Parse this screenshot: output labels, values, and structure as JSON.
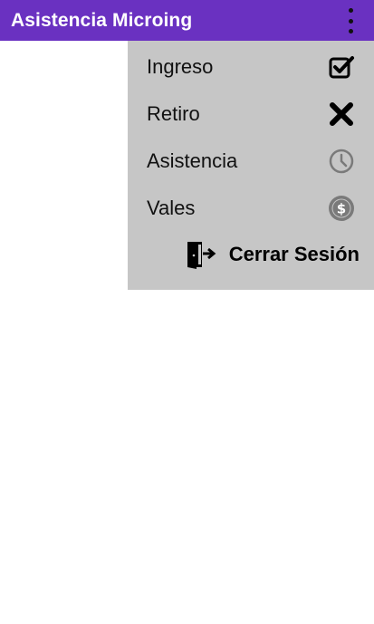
{
  "app_bar": {
    "title": "Asistencia Microing",
    "background": "#6a31c1",
    "overflow_icon": "more-vert-icon"
  },
  "menu": {
    "background": "#c6c6c6",
    "items": [
      {
        "label": "Ingreso",
        "icon": "checkbox-checked-icon"
      },
      {
        "label": "Retiro",
        "icon": "x-mark-icon"
      },
      {
        "label": "Asistencia",
        "icon": "clock-icon"
      },
      {
        "label": "Vales",
        "icon": "dollar-coin-icon"
      }
    ],
    "logout": {
      "label": "Cerrar Sesión",
      "icon": "exit-door-icon"
    }
  }
}
